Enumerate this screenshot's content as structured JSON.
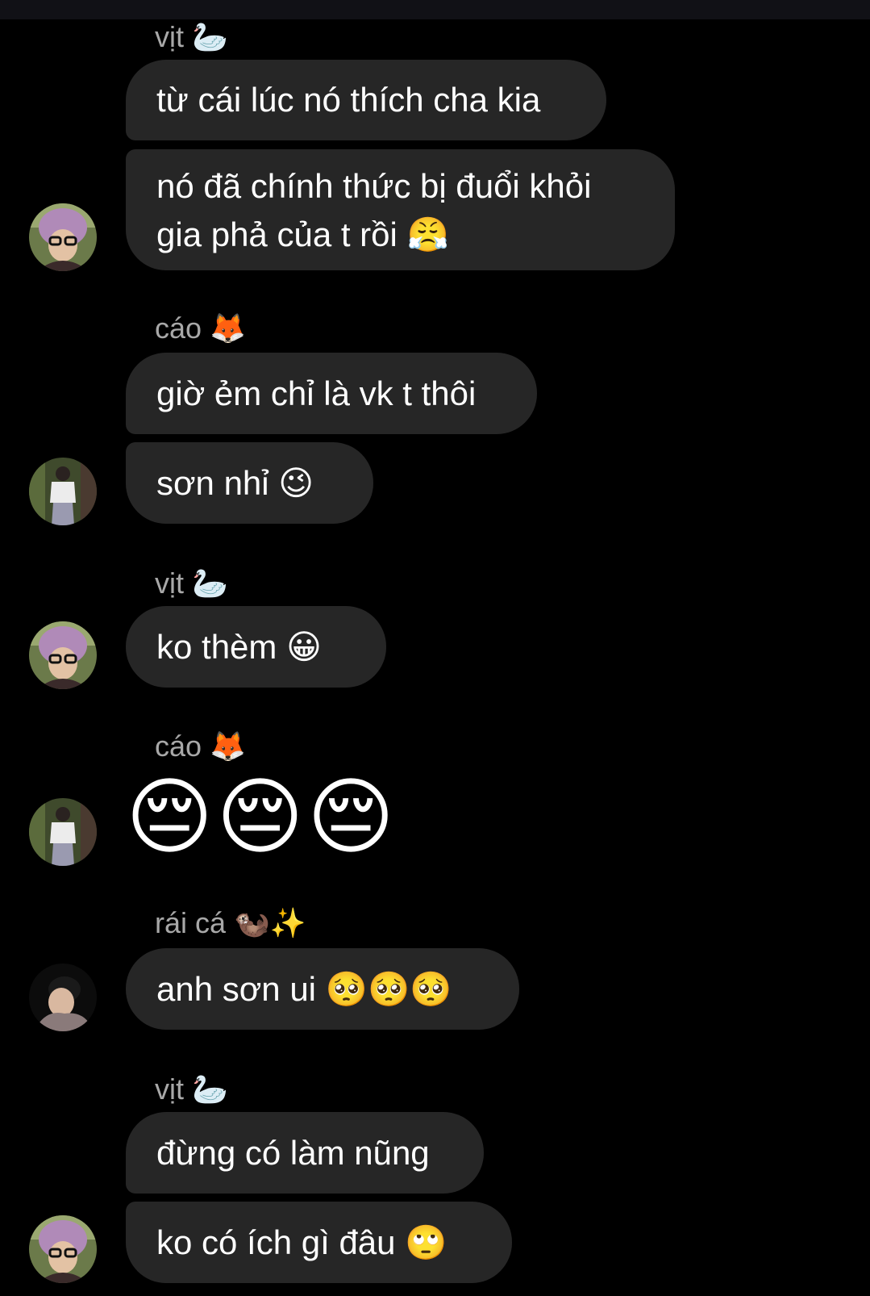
{
  "colors": {
    "background": "#000000",
    "bubble": "#262626",
    "sender": "#a8a8a8",
    "text": "#ffffff"
  },
  "thread": {
    "groups": [
      {
        "sender": "vịt 🦢",
        "avatar": "purple-beanie-avatar",
        "messages": [
          "từ cái lúc nó thích cha kia",
          "nó đã chính thức bị đuổi khỏi gia phả của t rồi 😤"
        ]
      },
      {
        "sender": "cáo 🦊",
        "avatar": "street-outfit-avatar",
        "messages": [
          "giờ ẻm chỉ là vk t thôi",
          "sơn nhỉ 😉"
        ]
      },
      {
        "sender": "vịt 🦢",
        "avatar": "purple-beanie-avatar",
        "messages": [
          "ko thèm 😀"
        ]
      },
      {
        "sender": "cáo 🦊",
        "avatar": "street-outfit-avatar",
        "messages": [
          "😔😔😔"
        ]
      },
      {
        "sender": "rái cá 🦦✨",
        "avatar": "selfie-avatar",
        "messages": [
          "anh sơn ui 🥺🥺🥺"
        ]
      },
      {
        "sender": "vịt 🦢",
        "avatar": "purple-beanie-avatar",
        "messages": [
          "đừng có làm nũng",
          "ko có ích gì đâu 🙄"
        ]
      }
    ]
  }
}
